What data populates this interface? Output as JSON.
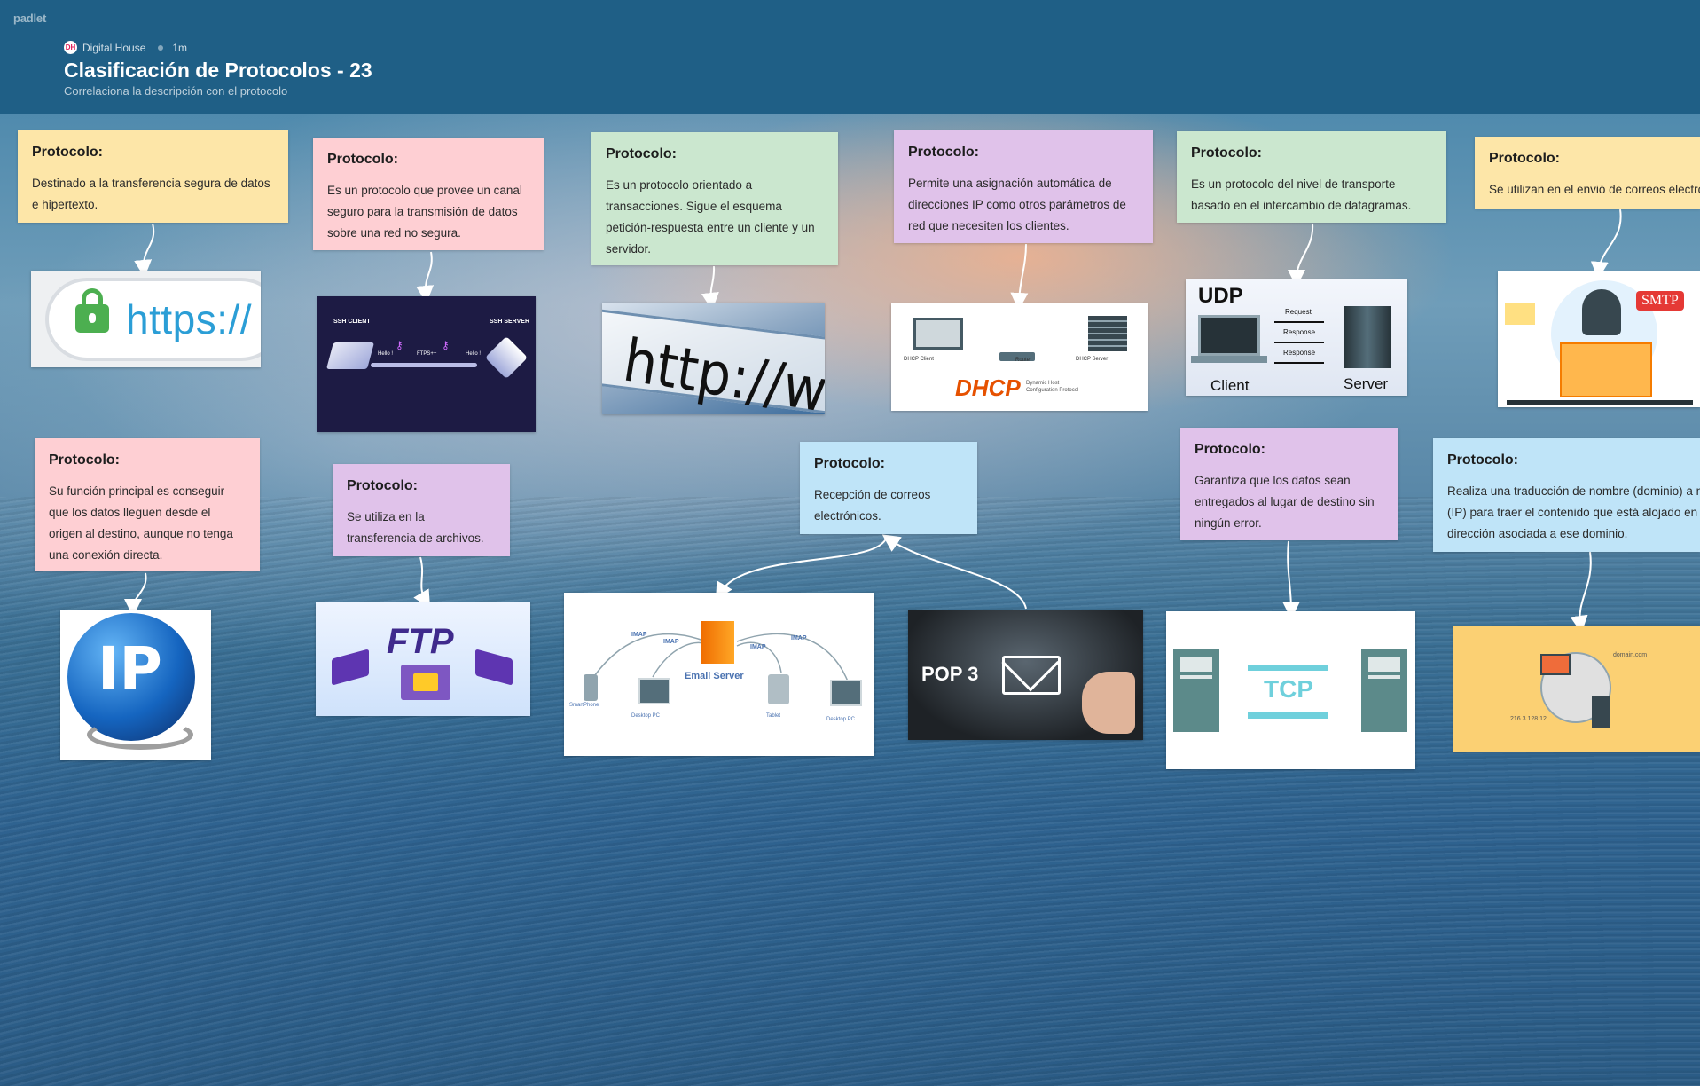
{
  "app": {
    "brand": "padlet",
    "author": "Digital House",
    "author_initial": "DH",
    "age": "1m",
    "title": "Clasificación de Protocolos - 23",
    "subtitle": "Correlaciona la descripción con el protocolo"
  },
  "cards": [
    {
      "heading": "Protocolo:",
      "text": "Destinado a la transferencia segura de datos e hipertexto."
    },
    {
      "heading": "Protocolo:",
      "text": "Es un protocolo que provee un canal seguro para la transmisión de datos sobre una red no segura."
    },
    {
      "heading": "Protocolo:",
      "text": "Es un protocolo orientado a transacciones. Sigue el esquema petición-respuesta entre un cliente y un servidor."
    },
    {
      "heading": "Protocolo:",
      "text": "Permite una asignación automática de direcciones IP como otros parámetros de red que necesiten los clientes."
    },
    {
      "heading": "Protocolo:",
      "text": "Es un protocolo del nivel de transporte basado en el intercambio de datagramas."
    },
    {
      "heading": "Protocolo:",
      "text": "Se utilizan en el envió de correos electrónicos."
    },
    {
      "heading": "Protocolo:",
      "text": "Su función principal es conseguir que los datos lleguen desde el origen al destino, aunque no tenga una conexión directa."
    },
    {
      "heading": "Protocolo:",
      "text": "Se utiliza en la transferencia de archivos."
    },
    {
      "heading": "Protocolo:",
      "text": "Recepción de correos electrónicos."
    },
    {
      "heading": "Protocolo:",
      "text": "Garantiza que los datos sean entregados al lugar de destino sin ningún error."
    },
    {
      "heading": "Protocolo:",
      "text": "Realiza una traducción de nombre (dominio) a número (IP) para traer el contenido que está alojado en esa dirección asociada a ese dominio."
    }
  ],
  "images": {
    "https": {
      "text": "https://"
    },
    "ssh": {
      "client": "SSH CLIENT",
      "server": "SSH SERVER",
      "hello1": "Hello !",
      "ftp": "FTPS++",
      "hello2": "Hello !"
    },
    "http": {
      "text": "http://www"
    },
    "dhcp": {
      "client": "DHCP Client",
      "router": "Router",
      "server": "DHCP Server",
      "logo": "DHCP",
      "desc1": "Dynamic Host",
      "desc2": "Configuration Protocol"
    },
    "udp": {
      "logo": "UDP",
      "request": "Request",
      "response1": "Response",
      "response2": "Response",
      "client": "Client",
      "server": "Server"
    },
    "smtp": {
      "badge": "SMTP"
    },
    "ip": {
      "text": "IP"
    },
    "ftp": {
      "logo": "FTP"
    },
    "imap": {
      "server": "Email Server",
      "imap": "IMAP",
      "smartphone": "SmartPhone",
      "desktop": "Desktop PC",
      "tablet": "Tablet"
    },
    "pop3": {
      "text": "POP 3"
    },
    "tcp": {
      "logo": "TCP"
    },
    "dns": {
      "domain": "domain.com",
      "ip": "216.3.128.12"
    }
  },
  "colors": {
    "header": "#1f5f86",
    "yellow": "#fde6a8",
    "pink": "#fecfd3",
    "green": "#cbe7cf",
    "violet": "#e0c2ea",
    "blue": "#bfe4f8"
  }
}
